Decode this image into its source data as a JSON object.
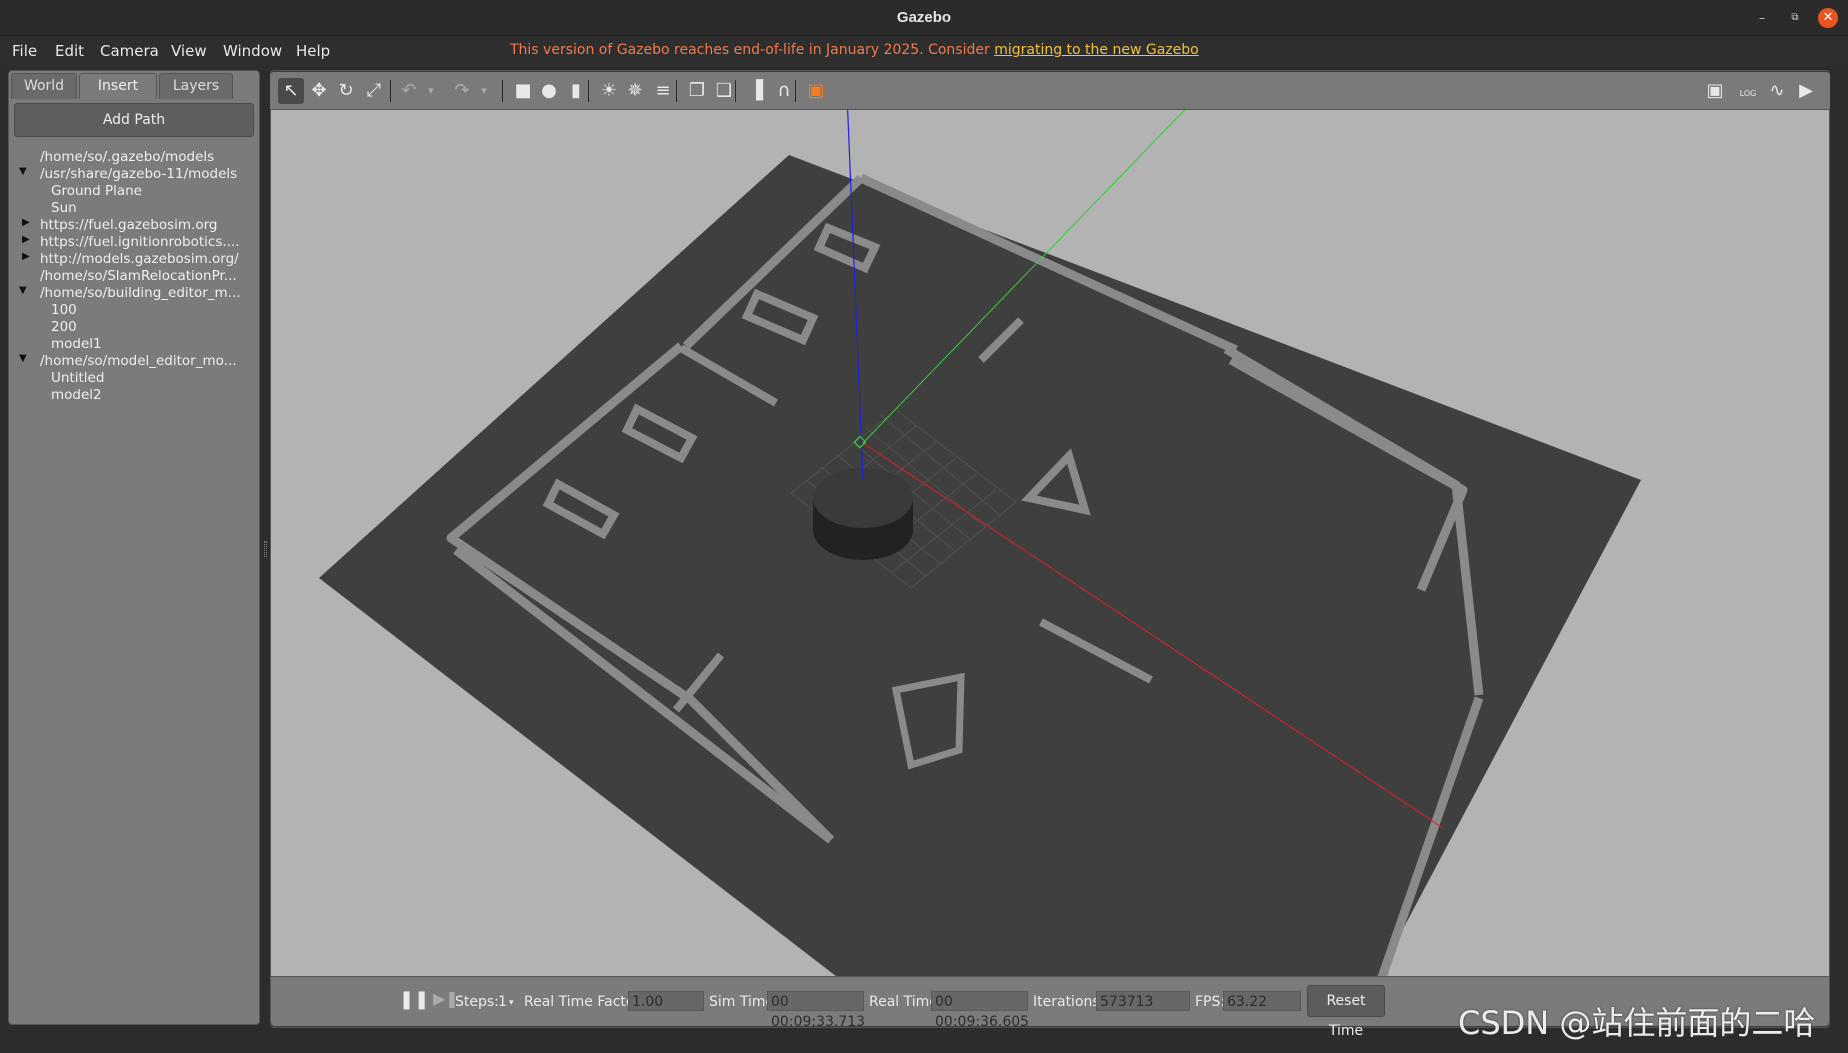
{
  "window": {
    "title": "Gazebo",
    "minimize_icon": "minimize-icon",
    "restore_icon": "restore-icon",
    "close_icon": "close-icon"
  },
  "menu": {
    "items": [
      "File",
      "Edit",
      "Camera",
      "View",
      "Window",
      "Help"
    ],
    "notice": "This version of Gazebo reaches end-of-life in January 2025. Consider ",
    "notice_link": "migrating to the new Gazebo"
  },
  "left_panel": {
    "tabs": [
      "World",
      "Insert",
      "Layers"
    ],
    "active_tab": "Insert",
    "add_path_label": "Add Path",
    "tree": [
      {
        "label": "/home/so/.gazebo/models",
        "indent": 0,
        "arrow": ""
      },
      {
        "label": "/usr/share/gazebo-11/models",
        "indent": 0,
        "arrow": "expanded"
      },
      {
        "label": "Ground Plane",
        "indent": 1,
        "arrow": ""
      },
      {
        "label": "Sun",
        "indent": 1,
        "arrow": ""
      },
      {
        "label": "https://fuel.gazebosim.org",
        "indent": 0,
        "arrow": "collapsed"
      },
      {
        "label": "https://fuel.ignitionrobotics....",
        "indent": 0,
        "arrow": "collapsed"
      },
      {
        "label": "http://models.gazebosim.org/",
        "indent": 0,
        "arrow": "collapsed"
      },
      {
        "label": "/home/so/SlamRelocationPr...",
        "indent": 0,
        "arrow": ""
      },
      {
        "label": "/home/so/building_editor_m...",
        "indent": 0,
        "arrow": "expanded"
      },
      {
        "label": "100",
        "indent": 1,
        "arrow": ""
      },
      {
        "label": "200",
        "indent": 1,
        "arrow": ""
      },
      {
        "label": "model1",
        "indent": 1,
        "arrow": ""
      },
      {
        "label": "/home/so/model_editor_mo...",
        "indent": 0,
        "arrow": "expanded"
      },
      {
        "label": "Untitled",
        "indent": 1,
        "arrow": ""
      },
      {
        "label": "model2",
        "indent": 1,
        "arrow": ""
      }
    ]
  },
  "toolbar": {
    "tools": [
      "select-arrow-icon",
      "translate-icon",
      "rotate-icon",
      "scale-icon",
      "undo-icon",
      "undo-dropdown-icon",
      "redo-icon",
      "redo-dropdown-icon",
      "box-icon",
      "sphere-icon",
      "cylinder-icon",
      "point-light-icon",
      "spot-light-icon",
      "directional-light-icon",
      "copy-icon",
      "paste-icon",
      "align-icon",
      "snap-icon",
      "view-angle-icon"
    ],
    "right_tools": [
      "screenshot-icon",
      "log-icon",
      "plot-icon",
      "video-record-icon"
    ],
    "log_text": "LOG"
  },
  "bottom_bar": {
    "steps_label": "Steps:",
    "steps_value": "1",
    "rtf_label": "Real Time Factor:",
    "rtf_value": "1.00",
    "sim_time_label": "Sim Time:",
    "sim_time_value": "00 00:09:33.713",
    "real_time_label": "Real Time:",
    "real_time_value": "00 00:09:36.605",
    "iterations_label": "Iterations:",
    "iterations_value": "573713",
    "fps_label": "FPS:",
    "fps_value": "63.22",
    "reset_label": "Reset Time"
  },
  "watermark": "CSDN @站住前面的二哈",
  "colors": {
    "sky": "#b3b3b3",
    "ground": "#3f3f3f",
    "wall": "#8a8a8a",
    "axis_x": "#e02020",
    "axis_y": "#30d030",
    "axis_z": "#2020e0",
    "eol_text": "#f07b4e",
    "eol_link": "#f0c040"
  }
}
